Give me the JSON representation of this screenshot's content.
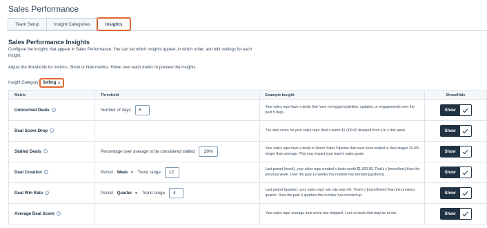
{
  "page_title": "Sales Performance",
  "tabs": [
    {
      "label": "Team Setup",
      "active": false
    },
    {
      "label": "Insight Categories",
      "active": false
    },
    {
      "label": "Insights",
      "active": true
    }
  ],
  "section_title": "Sales Performance Insights",
  "description": "Configure the insights that appear in Sales Performance. You can set which insights appear, in which order, and edit settings for each insight.",
  "description2": "Adjust the thresholds for metrics. Show or hide metrics. Hover over each metric to preview the insights.",
  "category": {
    "label": "Insight Category",
    "value": "Selling"
  },
  "table": {
    "headers": {
      "metric": "Metric",
      "threshold": "Threshold",
      "example": "Example Insight",
      "show_hide": "Show/Hide"
    },
    "rows": [
      {
        "metric": "Untouched Deals",
        "threshold_label": "Number of days",
        "threshold_value": "5",
        "example": "Your sales reps have x deals that have no logged activities, updates, or engagements over the past 5 days.",
        "toggle": "Show"
      },
      {
        "metric": "Deal Score Drop",
        "example": "The deal score for your sales reps' deal x worth $1,000.00 dropped from y to z this week.",
        "toggle": "Show"
      },
      {
        "metric": "Stalled Deals",
        "threshold_label": "Percentage over average to be considered stalled",
        "threshold_value": "20%",
        "example": "Your sales reps have x deals in Demo Sales Pipeline that have been stalled in deal stages 20.0% longer than average. This may impact your team's sales goals.",
        "toggle": "Show"
      },
      {
        "metric": "Deal Creation",
        "period_label": "Period",
        "period_value": "Week",
        "trend_label": "Trend range",
        "trend_value": "12",
        "example": "Last period (week), your sales reps created x deals worth $1,000.00. That's y [more/less] than the previous week. Over the past 12 weeks this number has trended [up/down].",
        "toggle": "Show"
      },
      {
        "metric": "Deal Win Rate",
        "period_label": "Period",
        "period_value": "Quarter",
        "trend_label": "Trend range",
        "trend_value": "4",
        "example": "Last period (quarter), your sales reps' win rate was x%. That's y [more/fewer] than the previous quarter. Over the past 4 quarters this number has trended up.",
        "toggle": "Show"
      },
      {
        "metric": "Average Deal Score",
        "example": "Your sales reps' average deal score has dropped. Look at deals that may be at risk.",
        "toggle": "Show"
      }
    ]
  },
  "colors": {
    "accent_outline": "#e0662f",
    "toggle_dark": "#213343"
  },
  "icons": {
    "info": "info-circle-icon",
    "check": "checkmark-icon",
    "caret": "caret-down-icon"
  }
}
